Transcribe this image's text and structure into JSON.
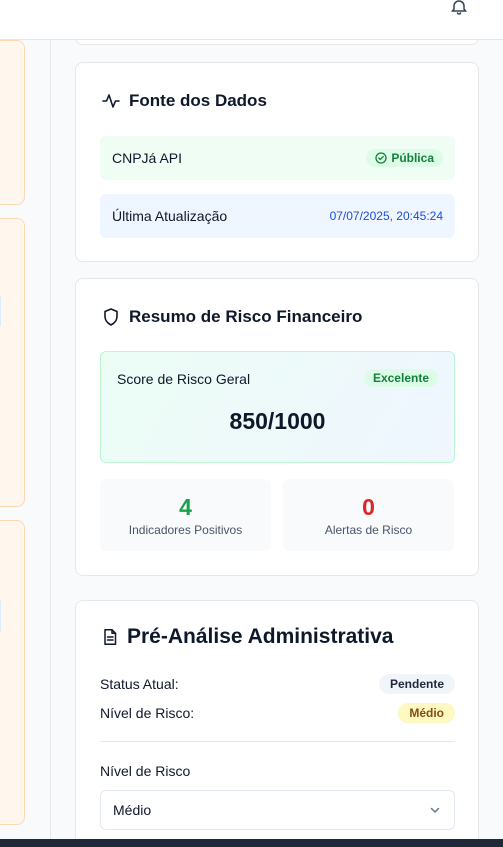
{
  "source": {
    "title": "Fonte dos Dados",
    "provider": "CNPJá API",
    "provider_badge": "Pública",
    "last_update_label": "Última Atualização",
    "last_update_value": "07/07/2025, 20:45:24"
  },
  "risk_summary": {
    "title": "Resumo de Risco Financeiro",
    "score_label": "Score de Risco Geral",
    "score_badge": "Excelente",
    "score_value": "850/1000",
    "positives_count": "4",
    "positives_label": "Indicadores Positivos",
    "alerts_count": "0",
    "alerts_label": "Alertas de Risco"
  },
  "pre_analysis": {
    "title": "Pré-Análise Administrativa",
    "status_label": "Status Atual:",
    "status_value": "Pendente",
    "risk_label": "Nível de Risco:",
    "risk_value": "Médio",
    "select_label": "Nível de Risco",
    "select_value": "Médio"
  },
  "colors": {
    "positive": "#16a34a",
    "alert": "#dc2626",
    "accent_blue": "#1d4ed8"
  },
  "icons": {
    "notifications": "bell-icon",
    "source": "activity-icon",
    "risk": "shield-icon",
    "pre_analysis": "document-icon",
    "select_toggle": "chevron-down-icon"
  }
}
